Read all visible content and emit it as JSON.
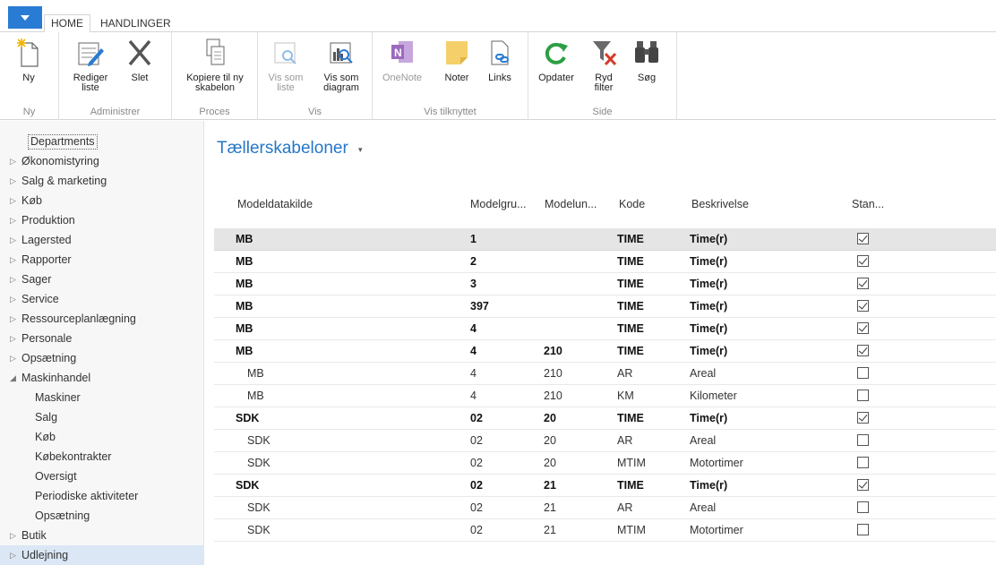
{
  "tabs": {
    "home": "HOME",
    "actions": "HANDLINGER"
  },
  "ribbon": {
    "groups": {
      "ny": "Ny",
      "administrer": "Administrer",
      "proces": "Proces",
      "vis": "Vis",
      "vis_tilknyttet": "Vis tilknyttet",
      "side": "Side"
    },
    "buttons": {
      "ny": "Ny",
      "rediger": "Rediger liste",
      "slet": "Slet",
      "kopiere": "Kopiere til ny skabelon",
      "vis_liste": "Vis som liste",
      "vis_diagram": "Vis som diagram",
      "onenote": "OneNote",
      "noter": "Noter",
      "links": "Links",
      "opdater": "Opdater",
      "ryd_filter": "Ryd filter",
      "sog": "Søg"
    },
    "colors": {
      "accent": "#2a7bd3",
      "onenote": "#7a3aa8",
      "note": "#f5d06a",
      "refresh": "#2e9e44",
      "clear": "#d63a2a"
    }
  },
  "sidebar": {
    "items": [
      {
        "label": "Departments",
        "arrow": ""
      },
      {
        "label": "Økonomistyring",
        "arrow": "▷"
      },
      {
        "label": "Salg & marketing",
        "arrow": "▷"
      },
      {
        "label": "Køb",
        "arrow": "▷"
      },
      {
        "label": "Produktion",
        "arrow": "▷"
      },
      {
        "label": "Lagersted",
        "arrow": "▷"
      },
      {
        "label": "Rapporter",
        "arrow": "▷"
      },
      {
        "label": "Sager",
        "arrow": "▷"
      },
      {
        "label": "Service",
        "arrow": "▷"
      },
      {
        "label": "Ressourceplanlægning",
        "arrow": "▷"
      },
      {
        "label": "Personale",
        "arrow": "▷"
      },
      {
        "label": "Opsætning",
        "arrow": "▷"
      },
      {
        "label": "Maskinhandel",
        "arrow": "◢"
      },
      {
        "label": "Maskiner",
        "arrow": ""
      },
      {
        "label": "Salg",
        "arrow": ""
      },
      {
        "label": "Køb",
        "arrow": ""
      },
      {
        "label": "Købekontrakter",
        "arrow": ""
      },
      {
        "label": "Oversigt",
        "arrow": ""
      },
      {
        "label": "Periodiske aktiviteter",
        "arrow": ""
      },
      {
        "label": "Opsætning",
        "arrow": ""
      },
      {
        "label": "Butik",
        "arrow": "▷"
      },
      {
        "label": "Udlejning",
        "arrow": "▷"
      }
    ]
  },
  "main": {
    "title": "Tællerskabeloner",
    "title_caret": "▾",
    "columns": [
      "Modeldatakilde",
      "Modelgru...",
      "Modelun...",
      "Kode",
      "Beskrivelse",
      "Stan..."
    ],
    "rows": [
      {
        "src": "MB",
        "grp": "1",
        "mdl": "",
        "code": "TIME",
        "desc": "Time(r)",
        "std": true
      },
      {
        "src": "MB",
        "grp": "2",
        "mdl": "",
        "code": "TIME",
        "desc": "Time(r)",
        "std": true
      },
      {
        "src": "MB",
        "grp": "3",
        "mdl": "",
        "code": "TIME",
        "desc": "Time(r)",
        "std": true
      },
      {
        "src": "MB",
        "grp": "397",
        "mdl": "",
        "code": "TIME",
        "desc": "Time(r)",
        "std": true
      },
      {
        "src": "MB",
        "grp": "4",
        "mdl": "",
        "code": "TIME",
        "desc": "Time(r)",
        "std": true
      },
      {
        "src": "MB",
        "grp": "4",
        "mdl": "210",
        "code": "TIME",
        "desc": "Time(r)",
        "std": true
      },
      {
        "src": "MB",
        "grp": "4",
        "mdl": "210",
        "code": "AR",
        "desc": "Areal",
        "std": false
      },
      {
        "src": "MB",
        "grp": "4",
        "mdl": "210",
        "code": "KM",
        "desc": "Kilometer",
        "std": false
      },
      {
        "src": "SDK",
        "grp": "02",
        "mdl": "20",
        "code": "TIME",
        "desc": "Time(r)",
        "std": true
      },
      {
        "src": "SDK",
        "grp": "02",
        "mdl": "20",
        "code": "AR",
        "desc": "Areal",
        "std": false
      },
      {
        "src": "SDK",
        "grp": "02",
        "mdl": "20",
        "code": "MTIM",
        "desc": "Motortimer",
        "std": false
      },
      {
        "src": "SDK",
        "grp": "02",
        "mdl": "21",
        "code": "TIME",
        "desc": "Time(r)",
        "std": true
      },
      {
        "src": "SDK",
        "grp": "02",
        "mdl": "21",
        "code": "AR",
        "desc": "Areal",
        "std": false
      },
      {
        "src": "SDK",
        "grp": "02",
        "mdl": "21",
        "code": "MTIM",
        "desc": "Motortimer",
        "std": false
      }
    ]
  }
}
